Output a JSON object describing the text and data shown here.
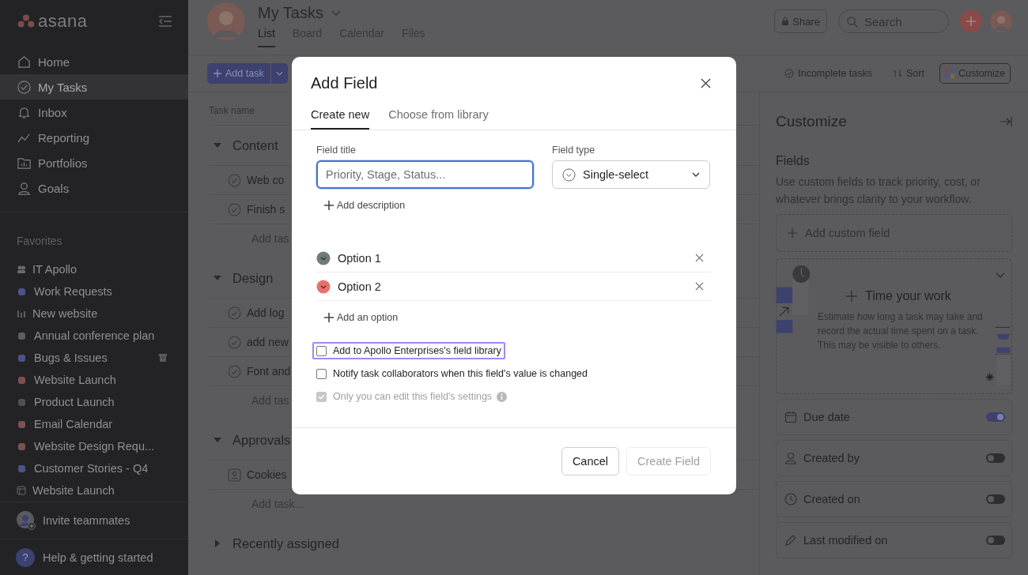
{
  "sidebar": {
    "logo": "asana",
    "nav": [
      {
        "label": "Home",
        "selected": false
      },
      {
        "label": "My Tasks",
        "selected": true
      },
      {
        "label": "Inbox",
        "selected": false
      },
      {
        "label": "Reporting",
        "selected": false
      },
      {
        "label": "Portfolios",
        "selected": false
      },
      {
        "label": "Goals",
        "selected": false
      }
    ],
    "favorites_title": "Favorites",
    "favorites": [
      {
        "kind": "team",
        "label": "IT Apollo",
        "archived": false
      },
      {
        "kind": "dot",
        "label": "Work Requests",
        "color": "#4d5388",
        "archived": false
      },
      {
        "kind": "chart",
        "label": "New website",
        "archived": false
      },
      {
        "kind": "dot",
        "label": "Annual conference plan",
        "color": "#5e5e60",
        "archived": false
      },
      {
        "kind": "dot",
        "label": "Bugs & Issues",
        "color": "#4d5388",
        "archived": true
      },
      {
        "kind": "dot",
        "label": "Website Launch",
        "color": "#7a5252",
        "archived": false
      },
      {
        "kind": "dot",
        "label": "Product Launch",
        "color": "#505052",
        "archived": false
      },
      {
        "kind": "dot",
        "label": "Email Calendar",
        "color": "#7a5252",
        "archived": false
      },
      {
        "kind": "dot",
        "label": "Website Design Requ...",
        "color": "#7a5252",
        "archived": false
      },
      {
        "kind": "dot",
        "label": "Customer Stories - Q4",
        "color": "#4d5388",
        "archived": false
      },
      {
        "kind": "board",
        "label": "Website Launch",
        "archived": false
      }
    ],
    "invite": "Invite teammates",
    "help": "Help & getting started",
    "help_badge": "?"
  },
  "header": {
    "title": "My Tasks",
    "tabs": [
      {
        "label": "List",
        "selected": true
      },
      {
        "label": "Board",
        "selected": false
      },
      {
        "label": "Calendar",
        "selected": false
      },
      {
        "label": "Files",
        "selected": false
      }
    ],
    "share": "Share",
    "search": {
      "placeholder": "Search"
    }
  },
  "toolbar": {
    "add_task": "Add task",
    "filters": [
      "Incomplete tasks",
      "Sort"
    ],
    "customize": "Customize"
  },
  "list": {
    "column": "Task name",
    "sections": [
      {
        "title": "Content",
        "expanded": true,
        "tasks": [
          {
            "kind": "task",
            "label": "Web co"
          },
          {
            "kind": "task",
            "label": "Finish s"
          },
          {
            "kind": "add",
            "label": "Add tas"
          }
        ]
      },
      {
        "title": "Design",
        "expanded": true,
        "tasks": [
          {
            "kind": "task",
            "label": "Add log"
          },
          {
            "kind": "task",
            "label": "add new"
          },
          {
            "kind": "task",
            "label": "Font and"
          },
          {
            "kind": "add",
            "label": "Add tas"
          }
        ]
      },
      {
        "title": "Approvals",
        "expanded": true,
        "tasks": [
          {
            "kind": "approval",
            "label": "Cookies"
          },
          {
            "kind": "add",
            "label": "Add task..."
          }
        ]
      },
      {
        "title": "Recently assigned",
        "expanded": false
      }
    ]
  },
  "customize": {
    "title": "Customize",
    "fields_title": "Fields",
    "description": "Use custom fields to track priority, cost, or whatever brings clarity to your workflow.",
    "add_custom_field": "Add custom field",
    "promo": {
      "title": "Time your work",
      "text": "Estimate how long a task may take and record the actual time spent on a task. This may be visible to others."
    },
    "fields": [
      {
        "label": "Due date",
        "on": true
      },
      {
        "label": "Created by",
        "on": false
      },
      {
        "label": "Created on",
        "on": false
      },
      {
        "label": "Last modified on",
        "on": false
      }
    ]
  },
  "dialog": {
    "title": "Add Field",
    "tabs": [
      {
        "label": "Create new",
        "selected": true
      },
      {
        "label": "Choose from library",
        "selected": false
      }
    ],
    "field_title": {
      "label": "Field title",
      "placeholder": "Priority, Stage, Status..."
    },
    "field_type": {
      "label": "Field type",
      "value": "Single-select"
    },
    "add_description": "Add description",
    "options": [
      {
        "label": "Option 1",
        "color": "#6f7c79"
      },
      {
        "label": "Option 2",
        "color": "#e8716d"
      }
    ],
    "add_option": "Add an option",
    "checkboxes": [
      {
        "label": "Add to Apollo Enterprises's field library",
        "checked": false,
        "disabled": false,
        "highlighted": true,
        "info": false
      },
      {
        "label": "Notify task collaborators when this field's value is changed",
        "checked": false,
        "disabled": false,
        "highlighted": false,
        "info": false
      },
      {
        "label": "Only you can edit this field's settings",
        "checked": true,
        "disabled": true,
        "highlighted": false,
        "info": true
      }
    ],
    "cancel": "Cancel",
    "create": {
      "label": "Create Field",
      "disabled": true
    }
  }
}
